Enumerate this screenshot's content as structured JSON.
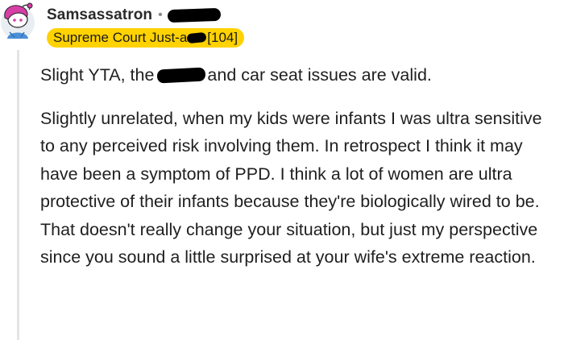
{
  "comment": {
    "username": "Samsassatron",
    "separator": "•",
    "flair": {
      "text_before": "Supreme Court Just-a",
      "text_after": "[104]",
      "color": "#ffd200"
    },
    "paragraph1": {
      "before": "Slight YTA, the",
      "after": "and car seat issues are valid."
    },
    "paragraph2": "Slightly unrelated, when my kids were infants I was ultra sensitive to any perceived risk involving them. In retrospect I think it may have been a symptom of PPD. I think a lot of women are ultra protective of their infants because they're biologically wired to be. That doesn't really change your situation, but just my perspective since you sound a little surprised at your wife's extreme reaction."
  },
  "colors": {
    "thread_line": "#e4e4e4",
    "redaction": "#000000",
    "avatar_pink": "#d63fa6",
    "avatar_blue": "#4a8fd6"
  },
  "icons": {
    "avatar": "snoo-avatar-icon"
  }
}
